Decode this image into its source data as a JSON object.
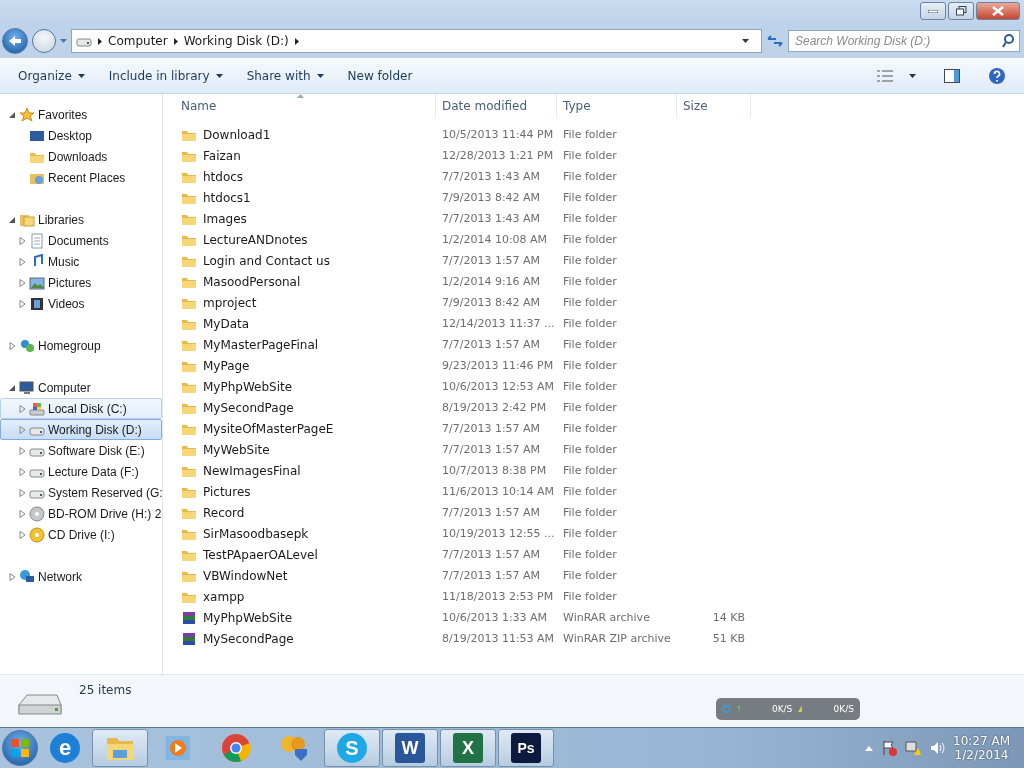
{
  "address_bar": {
    "crumbs": [
      "Computer",
      "Working Disk (D:)"
    ]
  },
  "search": {
    "placeholder": "Search Working Disk (D:)"
  },
  "toolbar": {
    "buttons": [
      {
        "label": "Organize",
        "dropdown": true
      },
      {
        "label": "Include in library",
        "dropdown": true
      },
      {
        "label": "Share with",
        "dropdown": true
      },
      {
        "label": "New folder",
        "dropdown": false
      }
    ]
  },
  "sidebar": {
    "groups": [
      {
        "label": "Favorites",
        "kind": "star",
        "expanded": true,
        "children": [
          {
            "label": "Desktop",
            "kind": "desktop",
            "selected": false,
            "hovered": false
          },
          {
            "label": "Downloads",
            "kind": "folder",
            "selected": false,
            "hovered": false
          },
          {
            "label": "Recent Places",
            "kind": "recent",
            "selected": false,
            "hovered": false
          }
        ]
      },
      {
        "label": "Libraries",
        "kind": "library",
        "expanded": true,
        "children": [
          {
            "label": "Documents",
            "kind": "document",
            "selected": false,
            "hovered": false
          },
          {
            "label": "Music",
            "kind": "music",
            "selected": false,
            "hovered": false
          },
          {
            "label": "Pictures",
            "kind": "picture",
            "selected": false,
            "hovered": false
          },
          {
            "label": "Videos",
            "kind": "video",
            "selected": false,
            "hovered": false
          }
        ]
      },
      {
        "label": "Homegroup",
        "kind": "homegroup",
        "expanded": false
      },
      {
        "label": "Computer",
        "kind": "computer",
        "expanded": true,
        "children": [
          {
            "label": "Local Disk (C:)",
            "kind": "windisk",
            "selected": false,
            "hovered": true
          },
          {
            "label": "Working Disk (D:)",
            "kind": "disk",
            "selected": true,
            "hovered": false
          },
          {
            "label": "Software Disk (E:)",
            "kind": "disk",
            "selected": false,
            "hovered": false
          },
          {
            "label": "Lecture Data (F:)",
            "kind": "disk",
            "selected": false,
            "hovered": false
          },
          {
            "label": "System Reserved (G:",
            "kind": "disk",
            "selected": false,
            "hovered": false
          },
          {
            "label": "BD-ROM Drive (H:) 2",
            "kind": "disc",
            "selected": false,
            "hovered": false
          },
          {
            "label": "CD Drive (I:)",
            "kind": "cd",
            "selected": false,
            "hovered": false
          }
        ]
      },
      {
        "label": "Network",
        "kind": "network",
        "expanded": false
      }
    ]
  },
  "table": {
    "columns": [
      {
        "label": "Name",
        "sorted": true
      },
      {
        "label": "Date modified",
        "sorted": false
      },
      {
        "label": "Type",
        "sorted": false
      },
      {
        "label": "Size",
        "sorted": false
      }
    ],
    "rows": [
      {
        "kind": "folder",
        "name": "Download1",
        "date": "10/5/2013 11:44 PM",
        "type": "File folder"
      },
      {
        "kind": "folder",
        "name": "Faizan",
        "date": "12/28/2013 1:21 PM",
        "type": "File folder"
      },
      {
        "kind": "folder",
        "name": "htdocs",
        "date": "7/7/2013 1:43 AM",
        "type": "File folder"
      },
      {
        "kind": "folder",
        "name": "htdocs1",
        "date": "7/9/2013 8:42 AM",
        "type": "File folder"
      },
      {
        "kind": "folder",
        "name": "Images",
        "date": "7/7/2013 1:43 AM",
        "type": "File folder"
      },
      {
        "kind": "folder",
        "name": "LectureANDnotes",
        "date": "1/2/2014 10:08 AM",
        "type": "File folder"
      },
      {
        "kind": "folder",
        "name": "Login and Contact us",
        "date": "7/7/2013 1:57 AM",
        "type": "File folder"
      },
      {
        "kind": "folder",
        "name": "MasoodPersonal",
        "date": "1/2/2014 9:16 AM",
        "type": "File folder"
      },
      {
        "kind": "folder",
        "name": "mproject",
        "date": "7/9/2013 8:42 AM",
        "type": "File folder"
      },
      {
        "kind": "folder",
        "name": "MyData",
        "date": "12/14/2013 11:37 ...",
        "type": "File folder"
      },
      {
        "kind": "folder",
        "name": "MyMasterPageFinal",
        "date": "7/7/2013 1:57 AM",
        "type": "File folder"
      },
      {
        "kind": "folder",
        "name": "MyPage",
        "date": "9/23/2013 11:46 PM",
        "type": "File folder"
      },
      {
        "kind": "folder",
        "name": "MyPhpWebSite",
        "date": "10/6/2013 12:53 AM",
        "type": "File folder"
      },
      {
        "kind": "folder",
        "name": "MySecondPage",
        "date": "8/19/2013 2:42 PM",
        "type": "File folder"
      },
      {
        "kind": "folder",
        "name": "MysiteOfMasterPageE",
        "date": "7/7/2013 1:57 AM",
        "type": "File folder"
      },
      {
        "kind": "folder",
        "name": "MyWebSite",
        "date": "7/7/2013 1:57 AM",
        "type": "File folder"
      },
      {
        "kind": "folder",
        "name": "NewImagesFinal",
        "date": "10/7/2013 8:38 PM",
        "type": "File folder"
      },
      {
        "kind": "folder",
        "name": "Pictures",
        "date": "11/6/2013 10:14 AM",
        "type": "File folder"
      },
      {
        "kind": "folder",
        "name": "Record",
        "date": "7/7/2013 1:57 AM",
        "type": "File folder"
      },
      {
        "kind": "folder",
        "name": "SirMasoodbasepk",
        "date": "10/19/2013 12:55 ...",
        "type": "File folder"
      },
      {
        "kind": "folder",
        "name": "TestPApaerOALevel",
        "date": "7/7/2013 1:57 AM",
        "type": "File folder"
      },
      {
        "kind": "folder",
        "name": "VBWindowNet",
        "date": "7/7/2013 1:57 AM",
        "type": "File folder"
      },
      {
        "kind": "folder",
        "name": "xampp",
        "date": "11/18/2013 2:53 PM",
        "type": "File folder"
      },
      {
        "kind": "archive",
        "name": "MyPhpWebSite",
        "date": "10/6/2013 1:33 AM",
        "type": "WinRAR archive",
        "size": "14 KB"
      },
      {
        "kind": "archive",
        "name": "MySecondPage",
        "date": "8/19/2013 11:53 AM",
        "type": "WinRAR ZIP archive",
        "size": "51 KB"
      }
    ]
  },
  "details": {
    "count": "25 items"
  },
  "speed_widget": {
    "down": "0K/S",
    "up": "0K/S"
  },
  "taskbar": {
    "apps": [
      {
        "kind": "ie",
        "glyph": "e",
        "active": false
      },
      {
        "kind": "explorer",
        "active": true
      },
      {
        "kind": "media",
        "active": false
      },
      {
        "kind": "chrome",
        "active": false
      },
      {
        "kind": "tool",
        "active": false
      },
      {
        "kind": "skype",
        "glyph": "S",
        "active": true
      },
      {
        "kind": "word",
        "glyph": "W",
        "active": true
      },
      {
        "kind": "excel",
        "glyph": "X",
        "active": true
      },
      {
        "kind": "photoshop",
        "glyph": "Ps",
        "active": true
      }
    ],
    "time": "10:27 AM",
    "date": "1/2/2014"
  }
}
